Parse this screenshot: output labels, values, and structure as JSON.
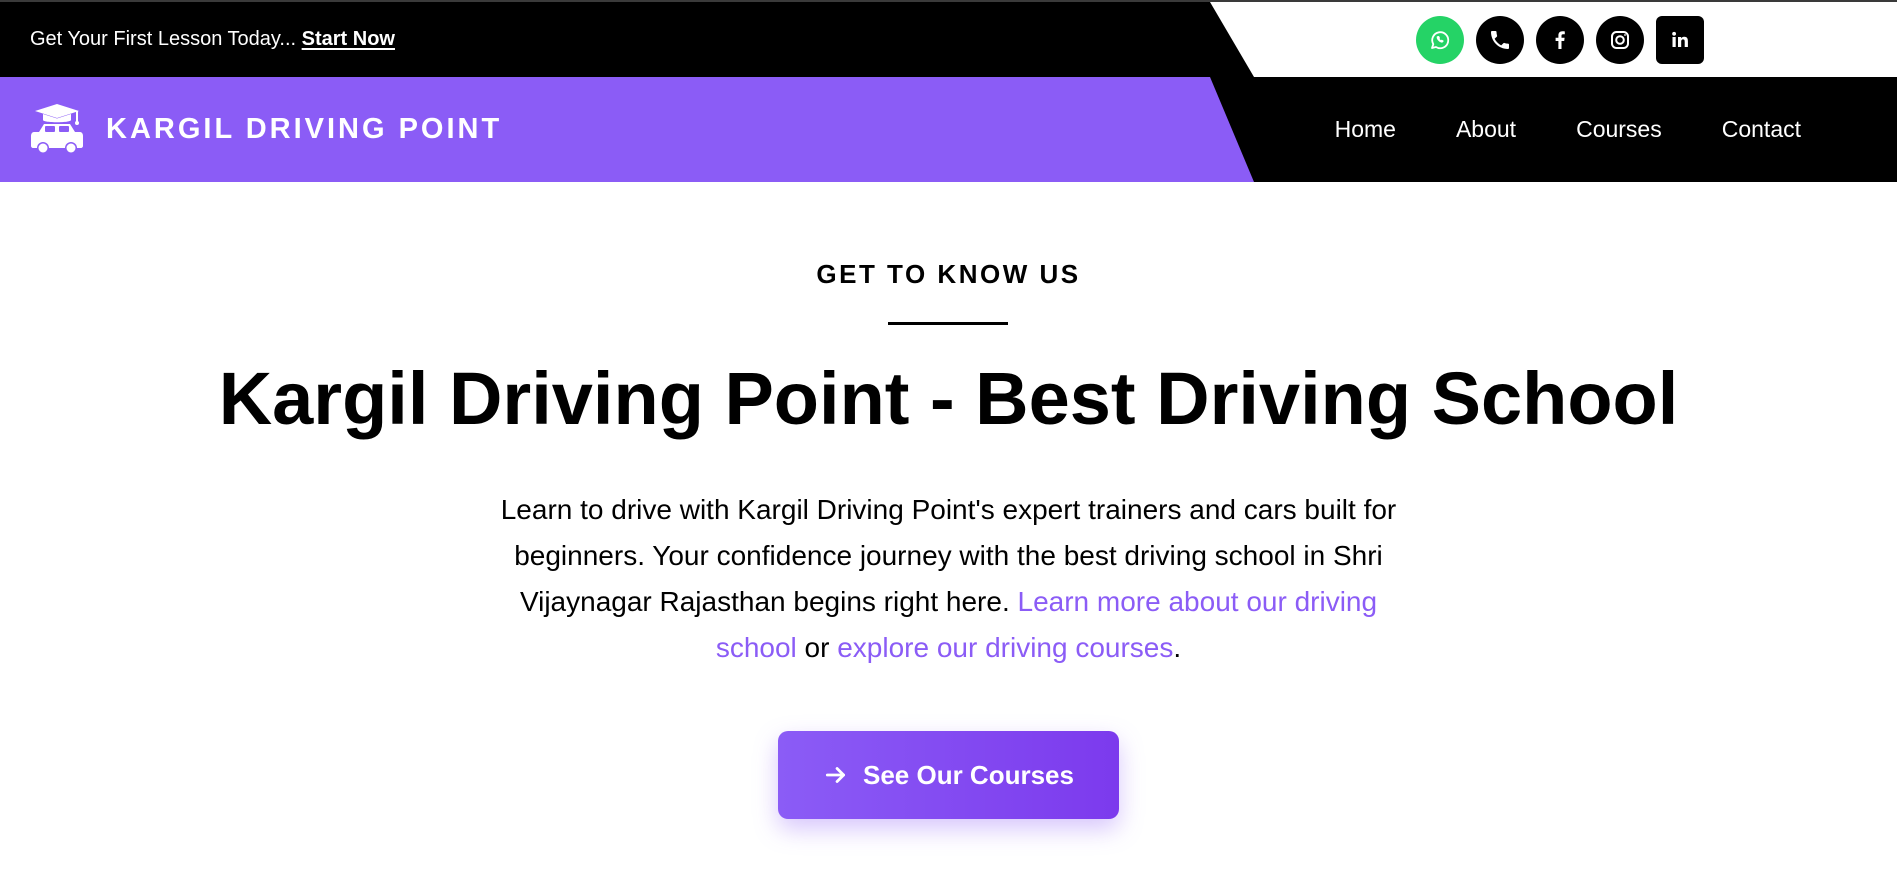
{
  "topbar": {
    "promo_text": "Get Your First Lesson Today...",
    "promo_link": "Start Now",
    "socials": [
      {
        "name": "whatsapp-icon",
        "color": "#25D366"
      },
      {
        "name": "phone-icon",
        "color": "#000000"
      },
      {
        "name": "facebook-icon",
        "color": "#000000"
      },
      {
        "name": "instagram-icon",
        "color": "#000000"
      },
      {
        "name": "linkedin-icon",
        "color": "#000000"
      }
    ]
  },
  "header": {
    "brand_name": "KARGIL DRIVING POINT",
    "logo_icon": "car-graduation-cap-icon",
    "nav": [
      "Home",
      "About",
      "Courses",
      "Contact"
    ]
  },
  "hero": {
    "eyebrow": "GET TO KNOW US",
    "title": "Kargil Driving Point - Best Driving School",
    "description": "Learn to drive with Kargil Driving Point's expert trainers and cars built for beginners. Your confidence journey with the best driving school in Shri Vijaynagar Rajasthan begins right here.",
    "link1": "Learn more about our driving school",
    "connector": "or",
    "link2": "explore our driving courses",
    "end_punct": ".",
    "cta_label": "See Our Courses",
    "cta_icon": "arrow-right-icon"
  },
  "colors": {
    "accent": "#8b5cf6",
    "dark": "#000000",
    "whatsapp": "#25D366"
  }
}
